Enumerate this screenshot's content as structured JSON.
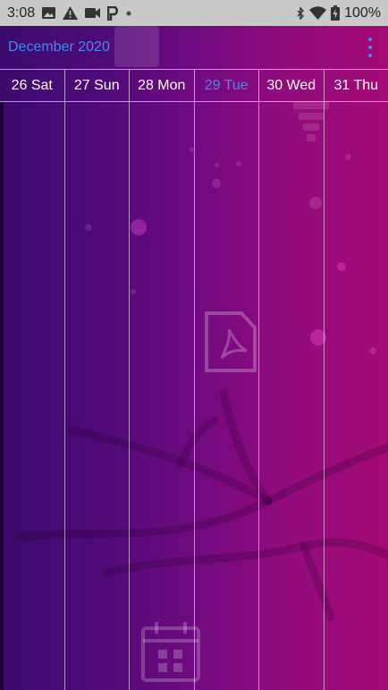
{
  "status_bar": {
    "time": "3:08",
    "battery": "100%"
  },
  "app_bar": {
    "month_title": "December 2020"
  },
  "days": [
    {
      "label": "26 Sat",
      "today": false
    },
    {
      "label": "27 Sun",
      "today": false
    },
    {
      "label": "28 Mon",
      "today": false
    },
    {
      "label": "29 Tue",
      "today": true
    },
    {
      "label": "30 Wed",
      "today": false
    },
    {
      "label": "31 Thu",
      "today": false
    }
  ],
  "colors": {
    "accent": "#3a8ff0",
    "status_bar_bg": "#c9c9c9",
    "gradient_start": "#3c0a6e",
    "gradient_end": "#a30a74"
  },
  "icons": {
    "status_left": [
      "image-icon",
      "warning-icon",
      "video-icon",
      "parking-icon",
      "dot-icon"
    ],
    "status_right": [
      "bluetooth-icon",
      "wifi-icon",
      "battery-icon"
    ],
    "background": [
      "chart-icon",
      "funnel-icon",
      "pdf-file-icon",
      "calendar-icon"
    ]
  }
}
